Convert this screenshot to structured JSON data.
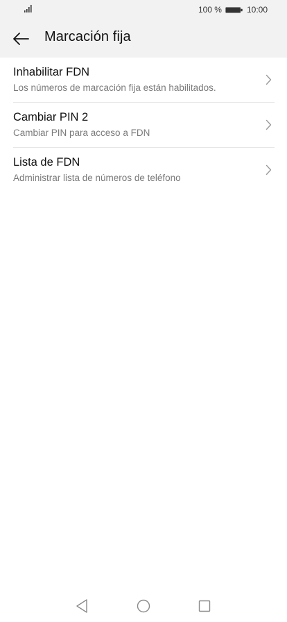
{
  "status_bar": {
    "battery_text": "100 %",
    "time": "10:00"
  },
  "header": {
    "title": "Marcación fija"
  },
  "items": [
    {
      "title": "Inhabilitar FDN",
      "subtitle": "Los números de marcación fija están habilitados."
    },
    {
      "title": "Cambiar PIN 2",
      "subtitle": "Cambiar PIN para acceso a FDN"
    },
    {
      "title": "Lista de FDN",
      "subtitle": "Administrar lista de números de teléfono"
    }
  ],
  "icons": {
    "signal": "signal-icon",
    "battery": "battery-icon",
    "back": "arrow-left-icon",
    "chevron": "chevron-right-icon",
    "nav_back": "triangle-back-icon",
    "nav_home": "circle-home-icon",
    "nav_recents": "square-recents-icon"
  },
  "colors": {
    "header_background": "#f2f2f2",
    "text_primary": "#111111",
    "text_secondary": "#7a7a7a",
    "divider": "#e3e3e3"
  }
}
